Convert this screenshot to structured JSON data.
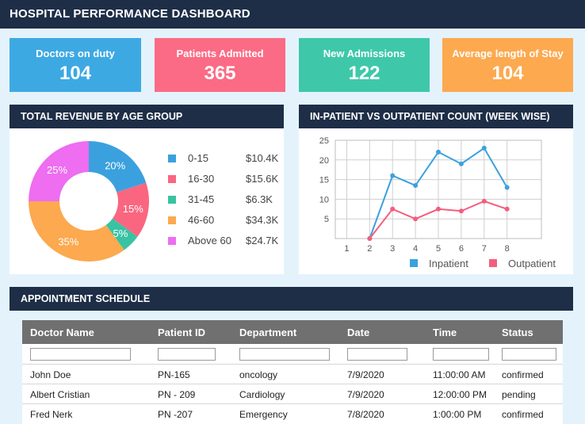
{
  "header": {
    "title": "HOSPITAL PERFORMANCE DASHBOARD"
  },
  "kpis": [
    {
      "label": "Doctors on duty",
      "value": "104",
      "color": "#3da9e3"
    },
    {
      "label": "Patients Admitted",
      "value": "365",
      "color": "#fb6b85"
    },
    {
      "label": "New Admissions",
      "value": "122",
      "color": "#3ec8a9"
    },
    {
      "label": "Average length of Stay",
      "value": "104",
      "color": "#fca94f"
    }
  ],
  "revenue": {
    "title": "TOTAL REVENUE BY AGE GROUP",
    "chart_data": {
      "type": "pie",
      "slices": [
        {
          "label": "0-15",
          "value": 20,
          "display": "20%",
          "amount": "$10.4K",
          "color": "#3aa1de"
        },
        {
          "label": "16-30",
          "value": 15,
          "display": "15%",
          "amount": "$15.6K",
          "color": "#fa6680"
        },
        {
          "label": "31-45",
          "value": 5,
          "display": "5%",
          "amount": "$6.3K",
          "color": "#38c3a3"
        },
        {
          "label": "46-60",
          "value": 35,
          "display": "35%",
          "amount": "$34.3K",
          "color": "#fca94f"
        },
        {
          "label": "Above 60",
          "value": 25,
          "display": "25%",
          "amount": "$24.7K",
          "color": "#ee6df0"
        }
      ]
    }
  },
  "counts": {
    "title": "IN-PATIENT VS OUTPATIENT COUNT (WEEK WISE)",
    "chart_data": {
      "type": "line",
      "x": [
        1,
        2,
        3,
        4,
        5,
        6,
        7,
        8
      ],
      "xlim": [
        0.5,
        9.5
      ],
      "ylim": [
        0,
        25
      ],
      "yticks": [
        5,
        10,
        15,
        20,
        25
      ],
      "grid": true,
      "legend": "bottom",
      "series": [
        {
          "name": "Inpatient",
          "color": "#3aa1de",
          "x": [
            2,
            3,
            4,
            5,
            6,
            7,
            8
          ],
          "values": [
            0,
            16,
            13.5,
            22,
            19,
            23,
            13
          ]
        },
        {
          "name": "Outpatient",
          "color": "#f45d7e",
          "x": [
            2,
            3,
            4,
            5,
            6,
            7,
            8
          ],
          "values": [
            0,
            7.5,
            5,
            7.5,
            7,
            9.5,
            7.5
          ]
        }
      ]
    }
  },
  "appointments": {
    "title": "APPOINTMENT SCHEDULE",
    "columns": [
      "Doctor Name",
      "Patient ID",
      "Department",
      "Date",
      "Time",
      "Status"
    ],
    "rows": [
      [
        "John Doe",
        "PN-165",
        "oncology",
        "7/9/2020",
        "11:00:00 AM",
        "confirmed"
      ],
      [
        "Albert Cristian",
        "PN - 209",
        "Cardiology",
        "7/9/2020",
        "12:00:00 PM",
        "pending"
      ],
      [
        "Fred Nerk",
        "PN -207",
        "Emergency",
        "7/8/2020",
        "1:00:00 PM",
        "confirmed"
      ]
    ]
  }
}
